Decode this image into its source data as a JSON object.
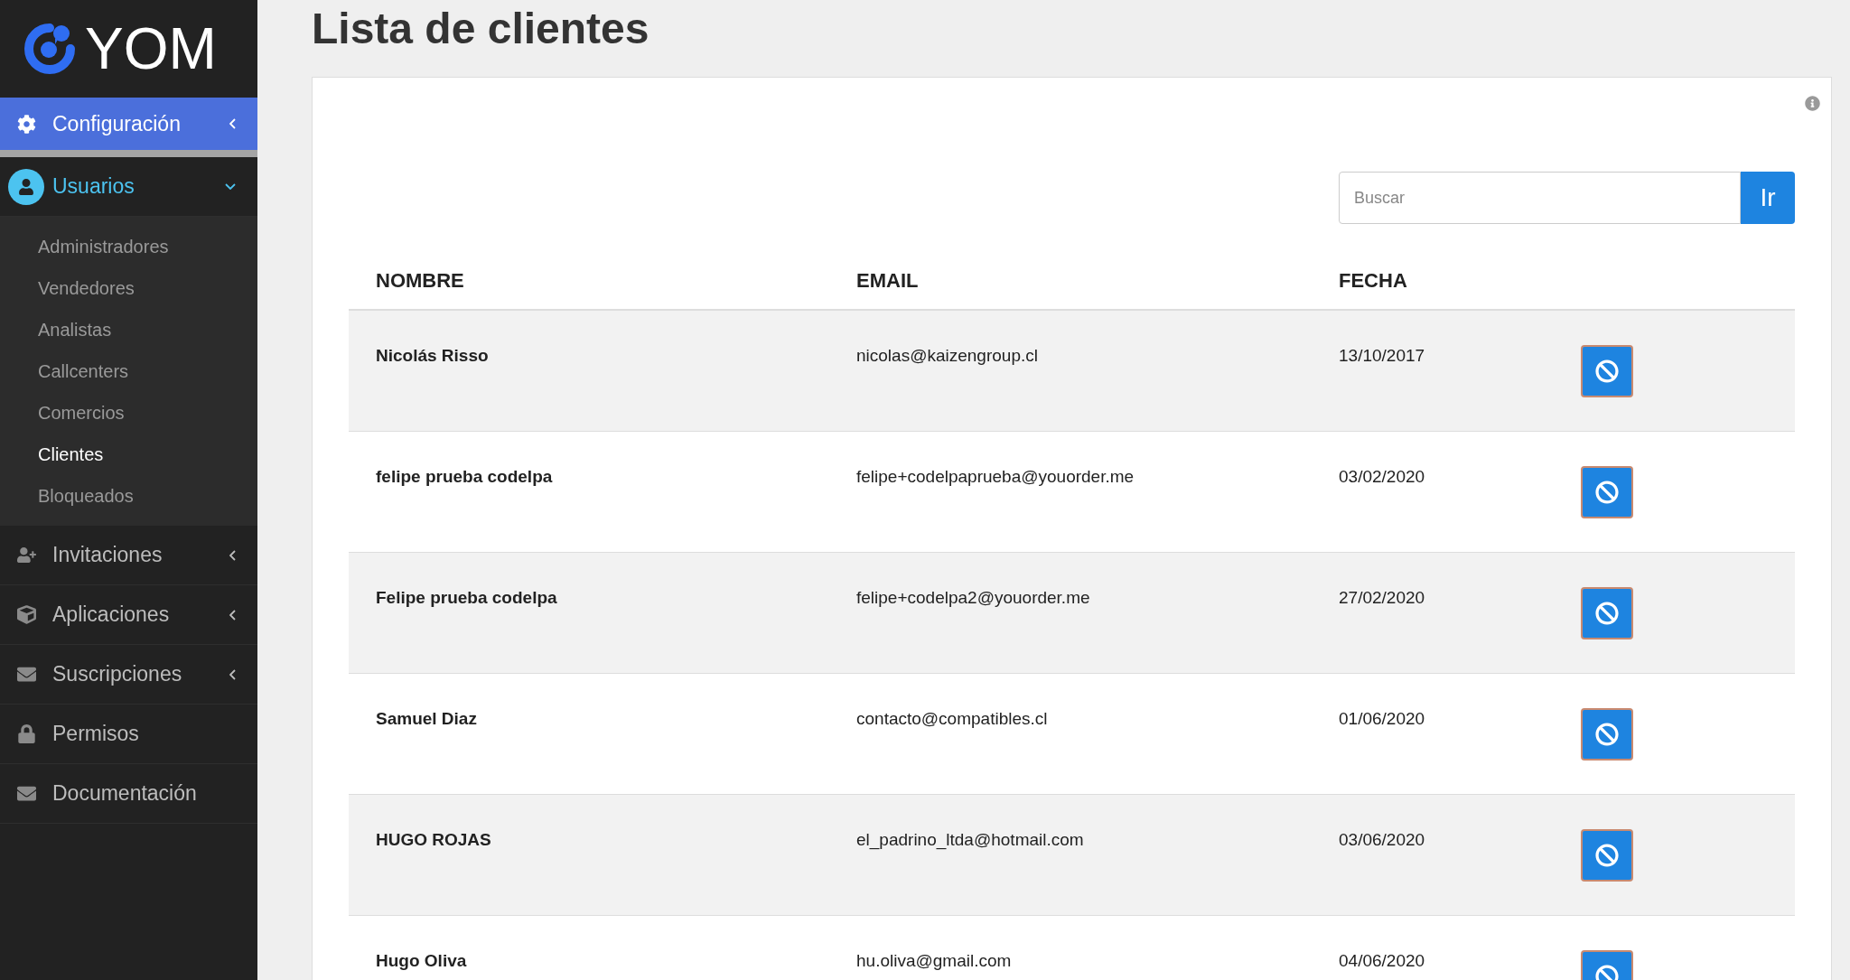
{
  "sidebar": {
    "logo": "YOM",
    "menu": [
      {
        "label": "Configuración",
        "selected": true,
        "expanded": false
      },
      {
        "label": "Usuarios",
        "selected": false,
        "expanded": true,
        "children": [
          {
            "label": "Administradores",
            "selected": false
          },
          {
            "label": "Vendedores",
            "selected": false
          },
          {
            "label": "Analistas",
            "selected": false
          },
          {
            "label": "Callcenters",
            "selected": false
          },
          {
            "label": "Comercios",
            "selected": false
          },
          {
            "label": "Clientes",
            "selected": true
          },
          {
            "label": "Bloqueados",
            "selected": false
          }
        ]
      },
      {
        "label": "Invitaciones",
        "selected": false,
        "expanded": false
      },
      {
        "label": "Aplicaciones",
        "selected": false,
        "expanded": false
      },
      {
        "label": "Suscripciones",
        "selected": false,
        "expanded": false
      },
      {
        "label": "Permisos",
        "selected": false
      },
      {
        "label": "Documentación",
        "selected": false
      }
    ]
  },
  "page_title": "Lista de clientes",
  "search": {
    "placeholder": "Buscar",
    "button": "Ir"
  },
  "table": {
    "columns": [
      "NOMBRE",
      "EMAIL",
      "FECHA"
    ],
    "rows": [
      [
        "Nicolás Risso",
        "nicolas@kaizengroup.cl",
        "13/10/2017"
      ],
      [
        "felipe prueba codelpa",
        "felipe+codelpaprueba@youorder.me",
        "03/02/2020"
      ],
      [
        "Felipe prueba codelpa",
        "felipe+codelpa2@youorder.me",
        "27/02/2020"
      ],
      [
        "Samuel Diaz",
        "contacto@compatibles.cl",
        "01/06/2020"
      ],
      [
        "HUGO ROJAS",
        "el_padrino_ltda@hotmail.com",
        "03/06/2020"
      ],
      [
        "Hugo Oliva",
        "hu.oliva@gmail.com",
        "04/06/2020"
      ]
    ]
  }
}
